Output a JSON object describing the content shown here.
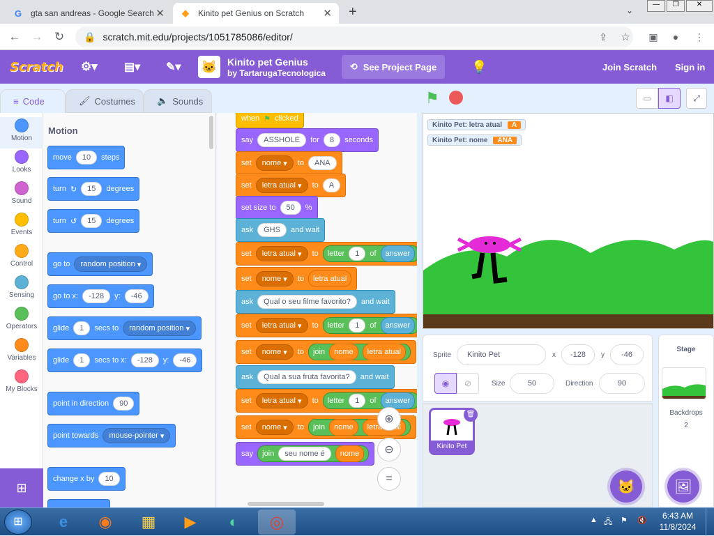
{
  "browser": {
    "tabs": [
      {
        "title": "gta san andreas - Google Search",
        "icon": "google-icon"
      },
      {
        "title": "Kinito pet Genius on Scratch",
        "icon": "scratch-icon"
      }
    ],
    "url": "scratch.mit.edu/projects/1051785086/editor/"
  },
  "menu": {
    "logo": "Scratch",
    "project_title": "Kinito pet Genius",
    "author": "by TartarugaTecnologica",
    "see_project": "See Project Page",
    "join": "Join Scratch",
    "signin": "Sign in"
  },
  "editor_tabs": {
    "code": "Code",
    "costumes": "Costumes",
    "sounds": "Sounds"
  },
  "categories": [
    {
      "label": "Motion",
      "color": "#4c97ff"
    },
    {
      "label": "Looks",
      "color": "#9966ff"
    },
    {
      "label": "Sound",
      "color": "#cf63cf"
    },
    {
      "label": "Events",
      "color": "#ffbf00"
    },
    {
      "label": "Control",
      "color": "#ffab19"
    },
    {
      "label": "Sensing",
      "color": "#5cb1d6"
    },
    {
      "label": "Operators",
      "color": "#59c059"
    },
    {
      "label": "Variables",
      "color": "#ff8c1a"
    },
    {
      "label": "My Blocks",
      "color": "#ff6680"
    }
  ],
  "palette": {
    "heading": "Motion",
    "move": "move",
    "move_val": "10",
    "steps": "steps",
    "turn": "turn",
    "turn_cw_val": "15",
    "degrees": "degrees",
    "turn_ccw_val": "15",
    "goto": "go to",
    "random_position": "random position",
    "goto_xy": "go to x:",
    "x_val": "-128",
    "y_label": "y:",
    "y_val": "-46",
    "glide": "glide",
    "glide_val": "1",
    "secs_to": "secs to",
    "secs_to_x": "secs to x:",
    "point_dir": "point in direction",
    "dir_val": "90",
    "point_towards": "point towards",
    "mouse_pointer": "mouse-pointer",
    "change_x": "change x by",
    "change_x_val": "10"
  },
  "script": {
    "when_clicked": "when",
    "clicked": "clicked",
    "say": "say",
    "say_text": "ASSHOLE",
    "for": "for",
    "secs": "8",
    "seconds": "seconds",
    "set": "set",
    "to": "to",
    "var_nome": "nome",
    "var_letra": "letra atual",
    "val_ana": "ANA",
    "val_a": "A",
    "set_size": "set size to",
    "size_val": "50",
    "percent": "%",
    "ask": "ask",
    "ask1": "GHS",
    "and_wait": "and wait",
    "letter": "letter",
    "letter_idx": "1",
    "of": "of",
    "answer": "answer",
    "ask2": "Qual o seu filme favorito?",
    "join": "join",
    "ask3": "Qual a sua fruta favorita?",
    "seu_nome": "seu nome é"
  },
  "monitors": [
    {
      "label": "Kinito Pet: letra atual",
      "value": "A"
    },
    {
      "label": "Kinito Pet: nome",
      "value": "ANA"
    }
  ],
  "sprite_info": {
    "sprite_label": "Sprite",
    "sprite_name": "Kinito Pet",
    "x_label": "x",
    "x": "-128",
    "y_label": "y",
    "y": "-46",
    "show_label": "Show",
    "size_label": "Size",
    "size": "50",
    "direction_label": "Direction",
    "direction": "90"
  },
  "sprite_list": [
    {
      "name": "Kinito Pet"
    }
  ],
  "stage_panel": {
    "title": "Stage",
    "backdrops_label": "Backdrops",
    "backdrops": "2"
  },
  "taskbar": {
    "time": "6:43 AM",
    "date": "11/8/2024"
  }
}
